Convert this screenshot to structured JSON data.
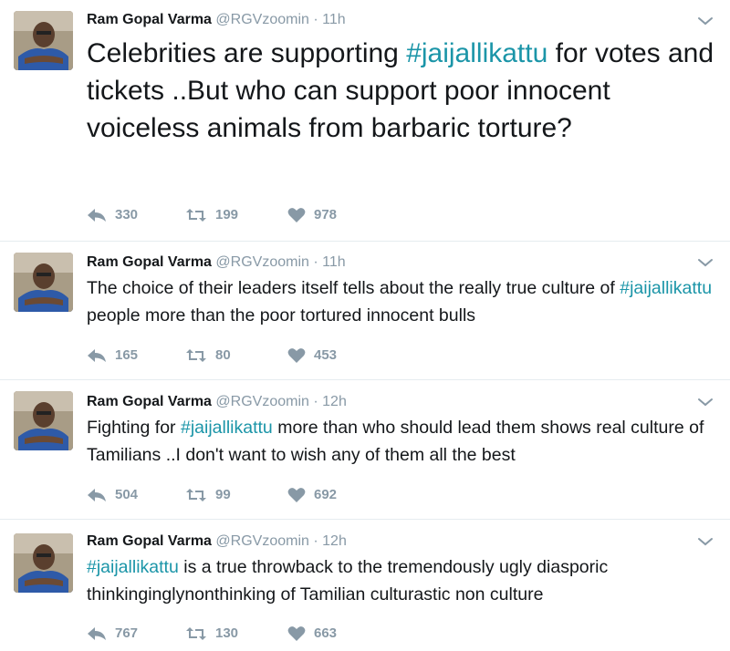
{
  "colors": {
    "hashtag": "#1b95a8",
    "muted": "#8899a6",
    "text": "#14171a",
    "divider": "#e6ecf0"
  },
  "tweets": [
    {
      "name": "Ram Gopal Varma",
      "handle": "@RGVzoomin",
      "separator": "·",
      "time": "11h",
      "text_parts": [
        {
          "text": "Celebrities are supporting ",
          "type": "plain"
        },
        {
          "text": "#jaijallikattu",
          "type": "hashtag"
        },
        {
          "text": " for votes and tickets ..But who can support poor innocent voiceless animals from barbaric torture?",
          "type": "plain"
        }
      ],
      "replies": "330",
      "retweets": "199",
      "likes": "978"
    },
    {
      "name": "Ram Gopal Varma",
      "handle": "@RGVzoomin",
      "separator": "·",
      "time": "11h",
      "text_parts": [
        {
          "text": "The choice of their leaders itself tells about the really true culture of ",
          "type": "plain"
        },
        {
          "text": "#jaijallikattu",
          "type": "hashtag"
        },
        {
          "text": " people more than the poor tortured innocent bulls",
          "type": "plain"
        }
      ],
      "replies": "165",
      "retweets": "80",
      "likes": "453"
    },
    {
      "name": "Ram Gopal Varma",
      "handle": "@RGVzoomin",
      "separator": "·",
      "time": "12h",
      "text_parts": [
        {
          "text": "Fighting for ",
          "type": "plain"
        },
        {
          "text": "#jaijallikattu",
          "type": "hashtag"
        },
        {
          "text": " more than who should lead them shows real culture of Tamilians ..I don't want to wish any of them all the best",
          "type": "plain"
        }
      ],
      "replies": "504",
      "retweets": "99",
      "likes": "692"
    },
    {
      "name": "Ram Gopal Varma",
      "handle": "@RGVzoomin",
      "separator": "·",
      "time": "12h",
      "text_parts": [
        {
          "text": "#jaijallikattu",
          "type": "hashtag"
        },
        {
          "text": " is a true throwback to the tremendously ugly diasporic thinkinginɡlynonthinking of Tamilian culturastic non culture",
          "type": "plain"
        }
      ],
      "replies": "767",
      "retweets": "130",
      "likes": "663"
    }
  ]
}
